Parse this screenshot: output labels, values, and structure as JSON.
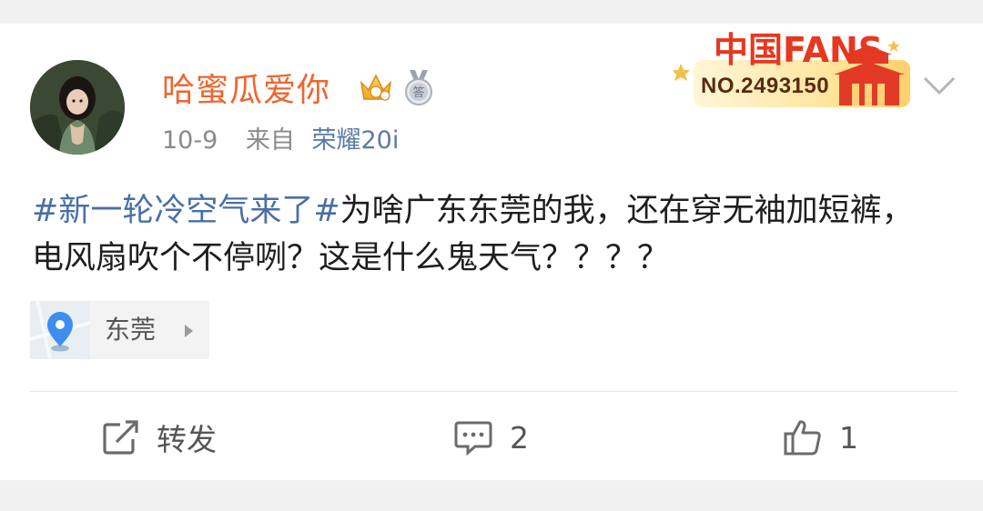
{
  "post": {
    "user": {
      "name": "哈蜜瓜爱你",
      "crown_icon": "vip-crown-icon",
      "medal_icon": "medal-icon",
      "medal_char": "答"
    },
    "meta": {
      "date": "10-9",
      "from_label": "来自",
      "device": "荣耀20i"
    },
    "fans_badge": {
      "title": "中国FANS",
      "number": "NO.2493150"
    },
    "content": {
      "topic": "#新一轮冷空气来了#",
      "text": "为啥广东东莞的我，还在穿无袖加短裤，电风扇吹个不停咧？这是什么鬼天气？？？？"
    },
    "location": {
      "label": "东莞",
      "icon": "location-pin-icon"
    },
    "actions": {
      "repost_label": "转发",
      "comment_count": "2",
      "like_count": "1"
    }
  },
  "colors": {
    "username": "#f0642d",
    "topic": "#4a6fa5",
    "meta": "#8a8a8a",
    "device": "#5b7ba7"
  }
}
